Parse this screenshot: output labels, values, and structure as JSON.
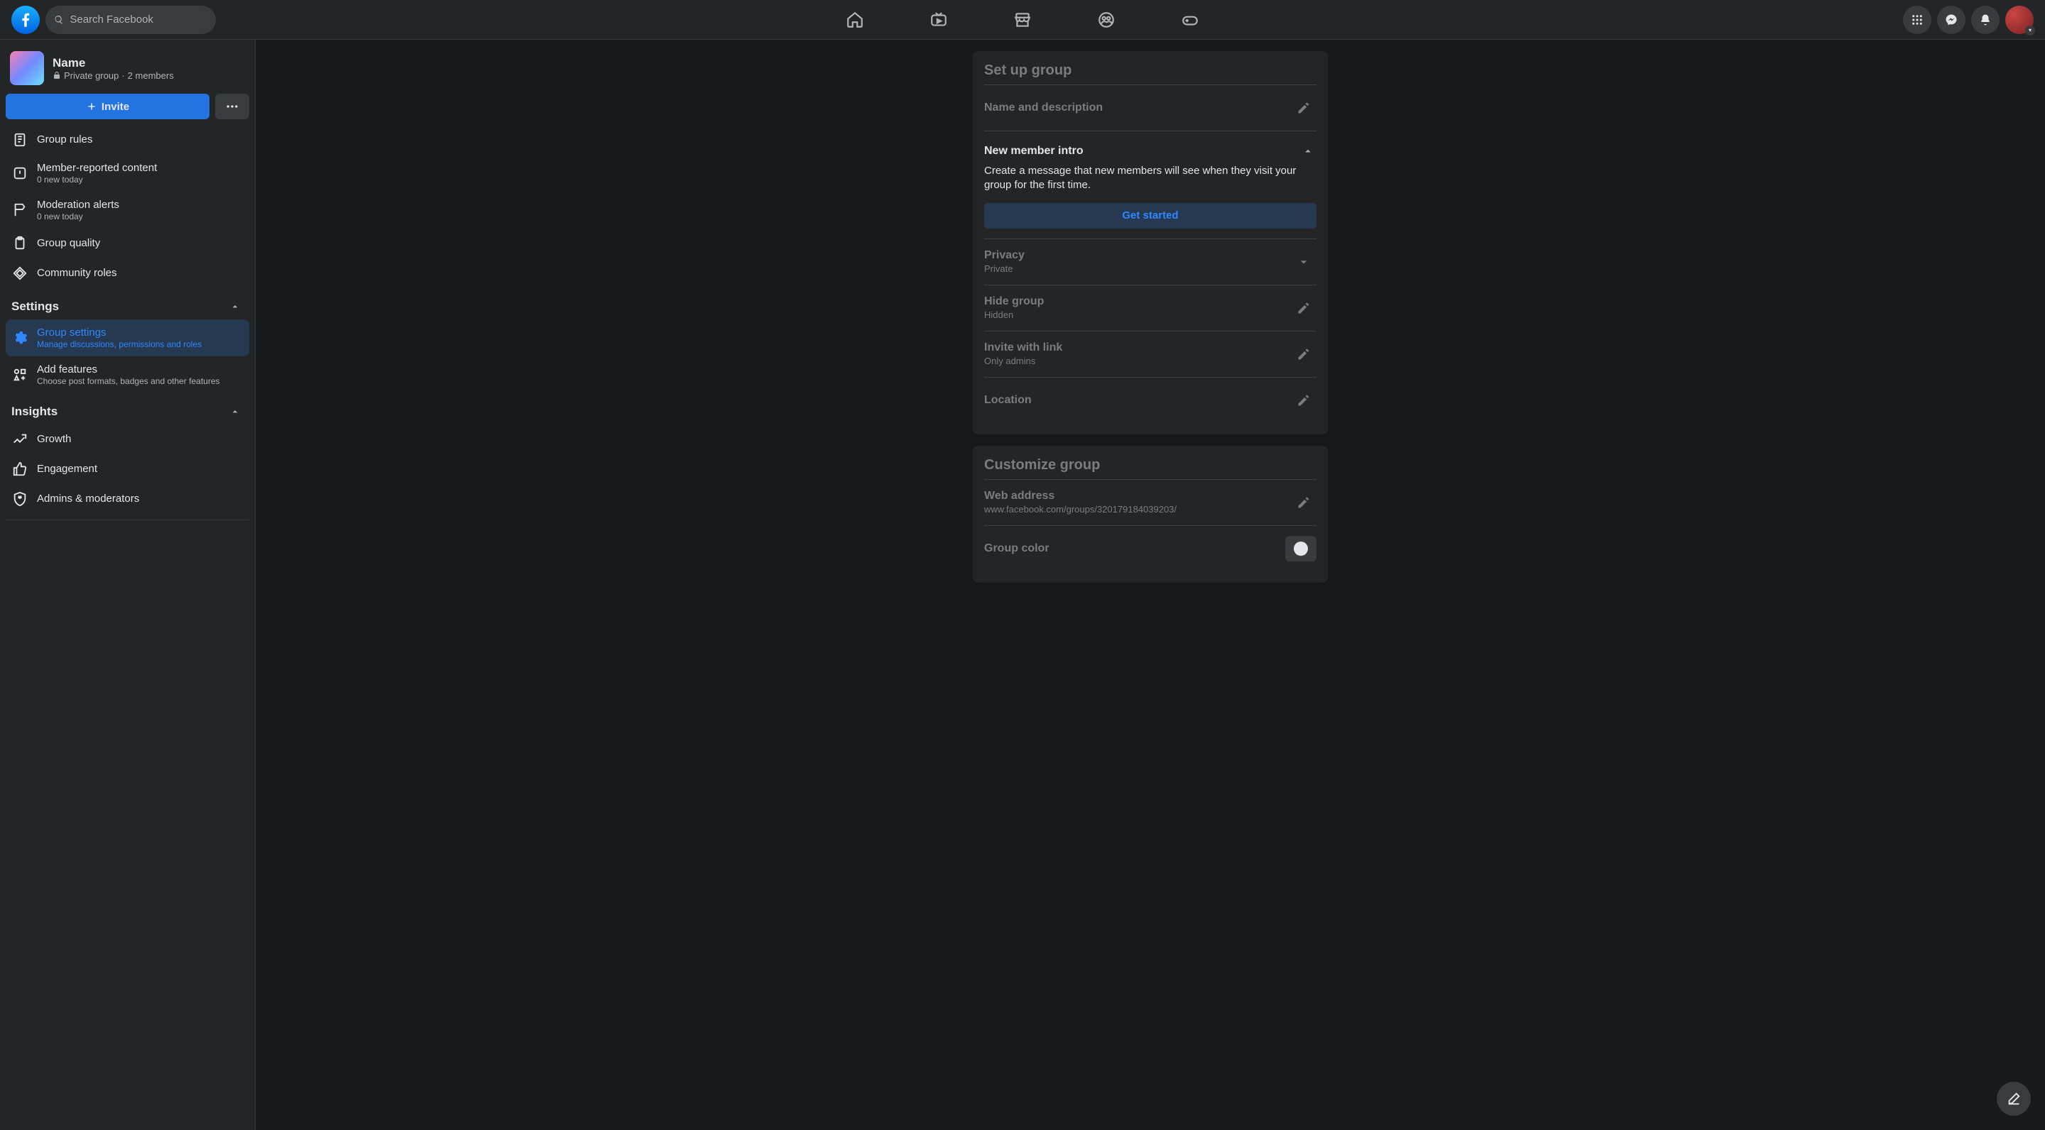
{
  "header": {
    "search_placeholder": "Search Facebook"
  },
  "sidebar": {
    "group_name": "Name",
    "privacy_label": "Private group",
    "member_count_label": "2 members",
    "invite_label": "Invite",
    "items": [
      {
        "label": "Group rules",
        "sub": null
      },
      {
        "label": "Member-reported content",
        "sub": "0 new today"
      },
      {
        "label": "Moderation alerts",
        "sub": "0 new today"
      },
      {
        "label": "Group quality",
        "sub": null
      },
      {
        "label": "Community roles",
        "sub": null
      }
    ],
    "sections": {
      "settings": {
        "title": "Settings",
        "items": [
          {
            "label": "Group settings",
            "sub": "Manage discussions, permissions and roles"
          },
          {
            "label": "Add features",
            "sub": "Choose post formats, badges and other features"
          }
        ]
      },
      "insights": {
        "title": "Insights",
        "items": [
          {
            "label": "Growth"
          },
          {
            "label": "Engagement"
          },
          {
            "label": "Admins & moderators"
          }
        ]
      }
    }
  },
  "main": {
    "setup": {
      "title": "Set up group",
      "name_desc": {
        "label": "Name and description"
      },
      "intro": {
        "label": "New member intro",
        "desc": "Create a message that new members will see when they visit your group for the first time.",
        "cta": "Get started"
      },
      "privacy": {
        "label": "Privacy",
        "value": "Private"
      },
      "hide": {
        "label": "Hide group",
        "value": "Hidden"
      },
      "invite_link": {
        "label": "Invite with link",
        "value": "Only admins"
      },
      "location": {
        "label": "Location"
      }
    },
    "customize": {
      "title": "Customize group",
      "web": {
        "label": "Web address",
        "value": "www.facebook.com/groups/320179184039203/"
      },
      "color": {
        "label": "Group color"
      }
    }
  }
}
